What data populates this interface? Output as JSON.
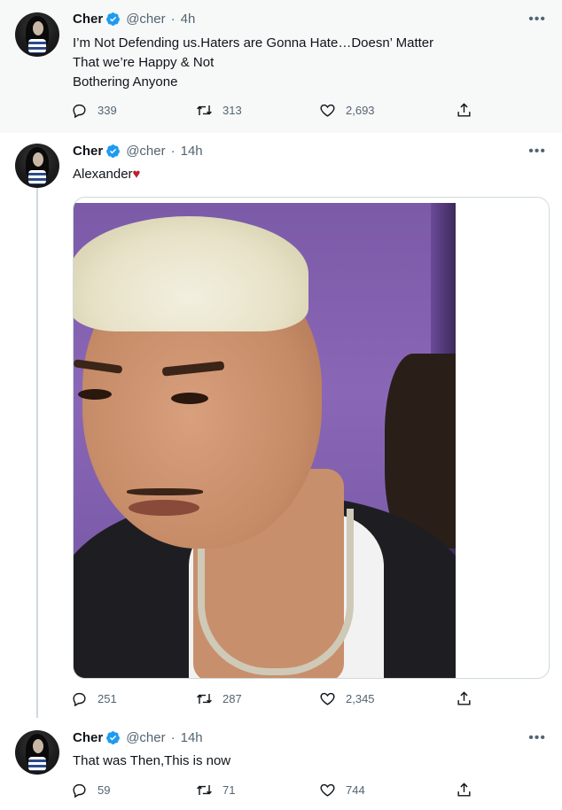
{
  "tweets": [
    {
      "name": "Cher",
      "handle": "@cher",
      "time": "4h",
      "lines": [
        "I’m Not Defending us.Haters are Gonna Hate…Doesn’ Matter",
        "That we’re Happy & Not",
        "Bothering Anyone"
      ],
      "replies": "339",
      "retweets": "313",
      "likes": "2,693"
    },
    {
      "name": "Cher",
      "handle": "@cher",
      "time": "14h",
      "lines": [
        "Alexander"
      ],
      "emoji": "♥",
      "replies": "251",
      "retweets": "287",
      "likes": "2,345"
    },
    {
      "name": "Cher",
      "handle": "@cher",
      "time": "14h",
      "lines": [
        "That was Then,This is now"
      ],
      "replies": "59",
      "retweets": "71",
      "likes": "744"
    }
  ],
  "separator": "·",
  "more_label": "•••",
  "colors": {
    "verified": "#1d9bf0",
    "heart": "#be1e2d",
    "muted": "#536471"
  }
}
